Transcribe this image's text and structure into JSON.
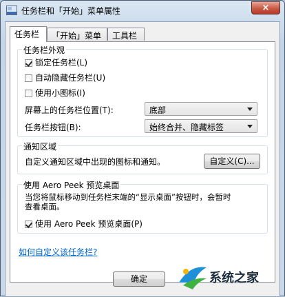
{
  "window": {
    "title": "任务栏和「开始」菜单属性",
    "close_label": "×"
  },
  "tabs": [
    {
      "label": "任务栏",
      "active": true
    },
    {
      "label": "「开始」菜单",
      "active": false
    },
    {
      "label": "工具栏",
      "active": false
    }
  ],
  "appearance": {
    "group_label": "任务栏外观",
    "lock_taskbar": {
      "label": "锁定任务栏(L)",
      "checked": true
    },
    "auto_hide": {
      "label": "自动隐藏任务栏(U)",
      "checked": false
    },
    "small_icons": {
      "label": "使用小图标(I)",
      "checked": false
    },
    "location_label": "屏幕上的任务栏位置(T):",
    "location_value": "底部",
    "buttons_label": "任务栏按钮(B):",
    "buttons_value": "始终合并、隐藏标签"
  },
  "notification": {
    "group_label": "通知区域",
    "description": "自定义通知区域中出现的图标和通知。",
    "customize_button": "自定义(C)..."
  },
  "aero_peek": {
    "group_label": "使用 Aero Peek 预览桌面",
    "description_line1": "当您将鼠标移动到任务栏末端的“显示桌面”按钮时，会暂时",
    "description_line2": "查看桌面。",
    "checkbox": {
      "label": "使用 Aero Peek 预览桌面(P)",
      "checked": true
    }
  },
  "help_link": "如何自定义该任务栏?",
  "footer": {
    "ok_button": "确定"
  },
  "watermark": {
    "text": "系统之家"
  }
}
